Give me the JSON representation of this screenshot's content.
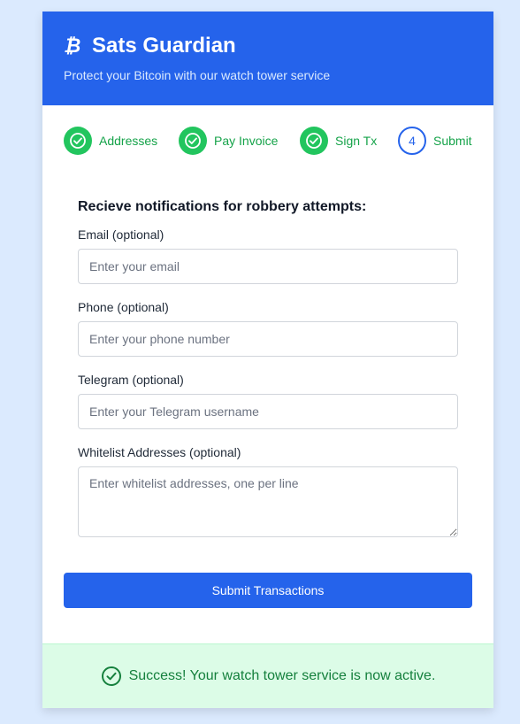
{
  "header": {
    "icon": "bitcoin-icon",
    "icon_glyph": "₿",
    "title": "Sats Guardian",
    "tagline": "Protect your Bitcoin with our watch tower service"
  },
  "steps": [
    {
      "label": "Addresses",
      "status": "complete",
      "icon": "check-circle-icon"
    },
    {
      "label": "Pay Invoice",
      "status": "complete",
      "icon": "check-circle-icon"
    },
    {
      "label": "Sign Tx",
      "status": "complete",
      "icon": "check-circle-icon"
    },
    {
      "label": "Submit",
      "status": "current",
      "number": "4"
    }
  ],
  "form": {
    "heading": "Recieve notifications for robbery attempts:",
    "email": {
      "label": "Email (optional)",
      "placeholder": "Enter your email",
      "value": ""
    },
    "phone": {
      "label": "Phone (optional)",
      "placeholder": "Enter your phone number",
      "value": ""
    },
    "telegram": {
      "label": "Telegram (optional)",
      "placeholder": "Enter your Telegram username",
      "value": ""
    },
    "whitelist": {
      "label": "Whitelist Addresses (optional)",
      "placeholder": "Enter whitelist addresses, one per line",
      "value": ""
    }
  },
  "submit_label": "Submit Transactions",
  "success": {
    "icon": "check-circle-icon",
    "message": "Success! Your watch tower service is now active."
  },
  "colors": {
    "primary": "#2563eb",
    "success": "#22c55e",
    "success_text": "#16a34a",
    "page_bg": "#dbeafe",
    "banner_bg": "#dcfce7"
  }
}
